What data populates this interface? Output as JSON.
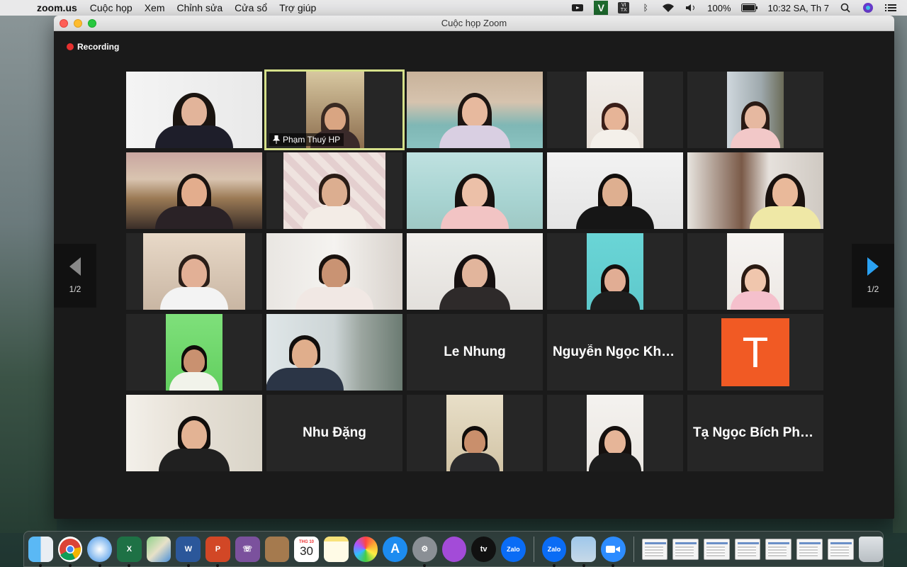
{
  "menubar": {
    "app": "zoom.us",
    "items": [
      "Cuộc họp",
      "Xem",
      "Chỉnh sửa",
      "Cửa sổ",
      "Trợ giúp"
    ],
    "battery": "100%",
    "clock": "10:32 SA, Th 7",
    "v_label": "V",
    "vitx_label": "VI TX"
  },
  "window": {
    "title": "Cuộc họp Zoom",
    "recording": "Recording"
  },
  "nav": {
    "left_page": "1/2",
    "right_page": "1/2"
  },
  "tiles": [
    {
      "type": "video",
      "name": ""
    },
    {
      "type": "video",
      "name": "Phạm Thuý HP",
      "active": true
    },
    {
      "type": "video",
      "name": ""
    },
    {
      "type": "video",
      "name": ""
    },
    {
      "type": "video",
      "name": ""
    },
    {
      "type": "video",
      "name": ""
    },
    {
      "type": "video",
      "name": ""
    },
    {
      "type": "video",
      "name": ""
    },
    {
      "type": "video",
      "name": ""
    },
    {
      "type": "video",
      "name": ""
    },
    {
      "type": "video",
      "name": ""
    },
    {
      "type": "video",
      "name": ""
    },
    {
      "type": "video",
      "name": ""
    },
    {
      "type": "video",
      "name": ""
    },
    {
      "type": "video",
      "name": ""
    },
    {
      "type": "video",
      "name": ""
    },
    {
      "type": "video",
      "name": ""
    },
    {
      "type": "name",
      "name": "Le Nhung"
    },
    {
      "type": "name",
      "name": "Nguyễn Ngọc Khá..."
    },
    {
      "type": "avatar",
      "initial": "T"
    },
    {
      "type": "video",
      "name": ""
    },
    {
      "type": "name",
      "name": "Nhu Đặng"
    },
    {
      "type": "video",
      "name": ""
    },
    {
      "type": "video",
      "name": ""
    },
    {
      "type": "name",
      "name": "Tạ Ngọc Bích Phư..."
    }
  ],
  "dock": {
    "calendar_month": "THG 10",
    "calendar_day": "30",
    "zalo_label": "Zalo",
    "tv_label": "tv"
  }
}
